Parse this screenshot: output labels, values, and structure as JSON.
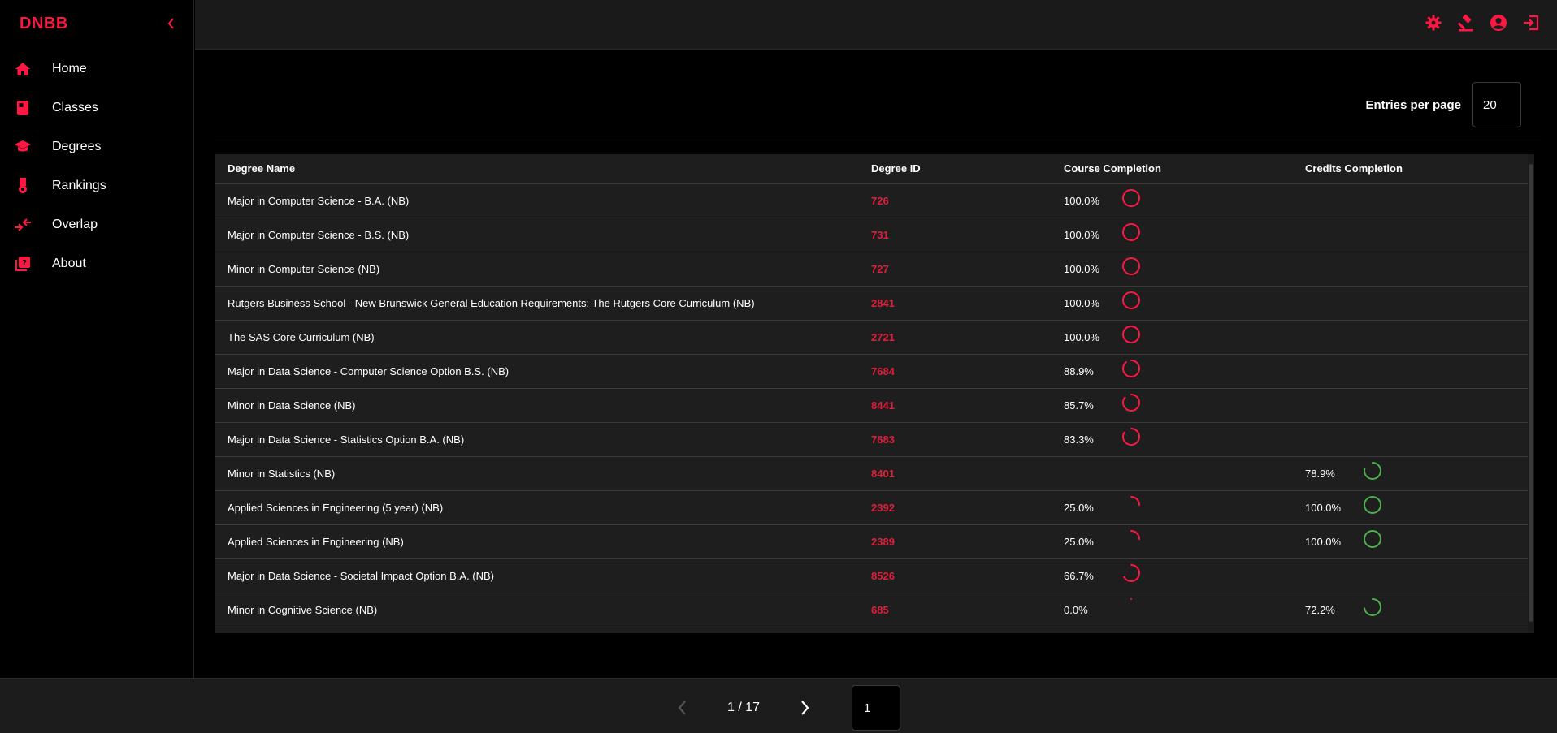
{
  "app": {
    "brand": "DNBB",
    "accent_color": "#ff1744",
    "success_color": "#4caf50"
  },
  "sidebar": {
    "collapse_icon": "chevron-left-icon",
    "items": [
      {
        "label": "Home",
        "icon": "home-icon"
      },
      {
        "label": "Classes",
        "icon": "book-icon"
      },
      {
        "label": "Degrees",
        "icon": "graduation-cap-icon"
      },
      {
        "label": "Rankings",
        "icon": "medal-icon"
      },
      {
        "label": "Overlap",
        "icon": "arrows-overlap-icon"
      },
      {
        "label": "About",
        "icon": "help-book-icon"
      }
    ]
  },
  "header": {
    "actions": [
      "gear-icon",
      "gavel-icon",
      "user-circle-icon",
      "logout-icon"
    ]
  },
  "main": {
    "entries_label": "Entries per page",
    "entries_value": "20",
    "table": {
      "columns": [
        "Degree Name",
        "Degree ID",
        "Course Completion",
        "Credits Completion"
      ],
      "rows": [
        {
          "name": "Major in Computer Science - B.A. (NB)",
          "id": "726",
          "course": "100.0%",
          "course_frac": 1.0,
          "credits": "",
          "credits_frac": null
        },
        {
          "name": "Major in Computer Science - B.S. (NB)",
          "id": "731",
          "course": "100.0%",
          "course_frac": 1.0,
          "credits": "",
          "credits_frac": null
        },
        {
          "name": "Minor in Computer Science (NB)",
          "id": "727",
          "course": "100.0%",
          "course_frac": 1.0,
          "credits": "",
          "credits_frac": null
        },
        {
          "name": "Rutgers Business School - New Brunswick General Education Requirements: The Rutgers Core Curriculum (NB)",
          "id": "2841",
          "course": "100.0%",
          "course_frac": 1.0,
          "credits": "",
          "credits_frac": null
        },
        {
          "name": "The SAS Core Curriculum (NB)",
          "id": "2721",
          "course": "100.0%",
          "course_frac": 1.0,
          "credits": "",
          "credits_frac": null
        },
        {
          "name": "Major in Data Science - Computer Science Option B.S. (NB)",
          "id": "7684",
          "course": "88.9%",
          "course_frac": 0.889,
          "credits": "",
          "credits_frac": null
        },
        {
          "name": "Minor in Data Science (NB)",
          "id": "8441",
          "course": "85.7%",
          "course_frac": 0.857,
          "credits": "",
          "credits_frac": null
        },
        {
          "name": "Major in Data Science - Statistics Option B.A. (NB)",
          "id": "7683",
          "course": "83.3%",
          "course_frac": 0.833,
          "credits": "",
          "credits_frac": null
        },
        {
          "name": "Minor in Statistics (NB)",
          "id": "8401",
          "course": "",
          "course_frac": null,
          "credits": "78.9%",
          "credits_frac": 0.789
        },
        {
          "name": "Applied Sciences in Engineering (5 year) (NB)",
          "id": "2392",
          "course": "25.0%",
          "course_frac": 0.25,
          "credits": "100.0%",
          "credits_frac": 1.0
        },
        {
          "name": "Applied Sciences in Engineering (NB)",
          "id": "2389",
          "course": "25.0%",
          "course_frac": 0.25,
          "credits": "100.0%",
          "credits_frac": 1.0
        },
        {
          "name": "Major in Data Science - Societal Impact Option B.A. (NB)",
          "id": "8526",
          "course": "66.7%",
          "course_frac": 0.667,
          "credits": "",
          "credits_frac": null
        },
        {
          "name": "Minor in Cognitive Science (NB)",
          "id": "685",
          "course": "0.0%",
          "course_frac": 0.0,
          "credits": "72.2%",
          "credits_frac": 0.722
        }
      ]
    }
  },
  "pagination": {
    "indicator": "1 / 17",
    "page_value": "1",
    "prev_icon": "chevron-left-icon",
    "next_icon": "chevron-right-icon"
  }
}
